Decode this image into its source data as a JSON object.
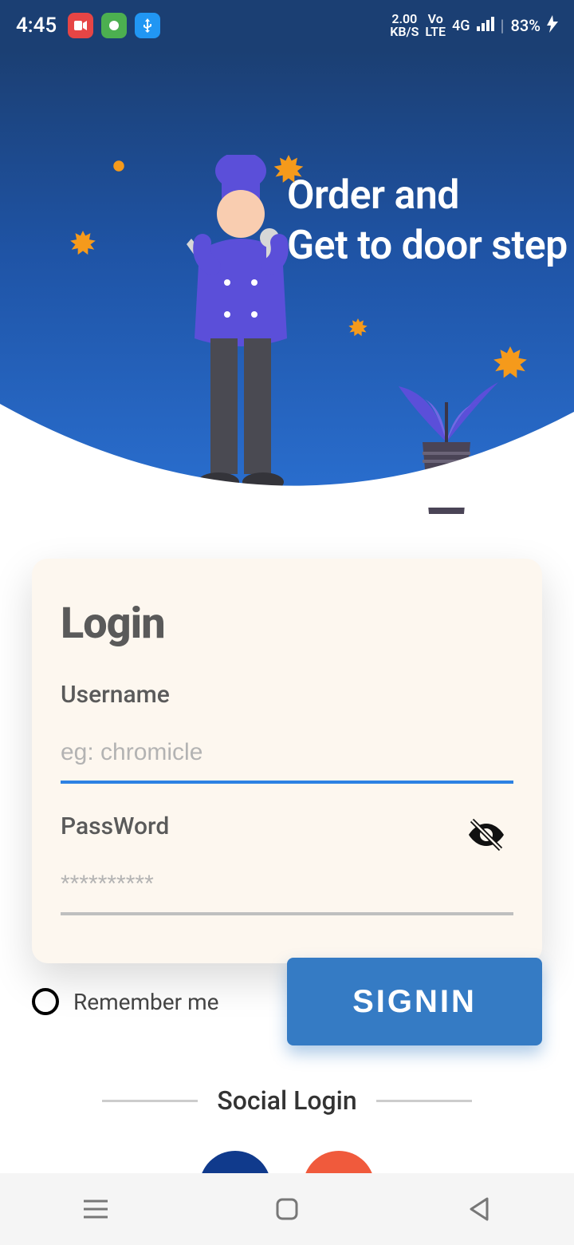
{
  "status": {
    "time": "4:45",
    "net_speed": "2.00",
    "net_unit": "KB/S",
    "volte_top": "Vo",
    "volte_bot": "LTE",
    "signal": "4G",
    "battery": "83%"
  },
  "hero": {
    "line1": "Order and",
    "line2": "Get to door step"
  },
  "login": {
    "title": "Login",
    "username_label": "Username",
    "username_placeholder": "eg: chromicle",
    "password_label": "PassWord",
    "password_placeholder": "**********"
  },
  "actions": {
    "remember_label": "Remember me",
    "signin_label": "SIGNIN"
  },
  "social": {
    "title": "Social Login"
  }
}
